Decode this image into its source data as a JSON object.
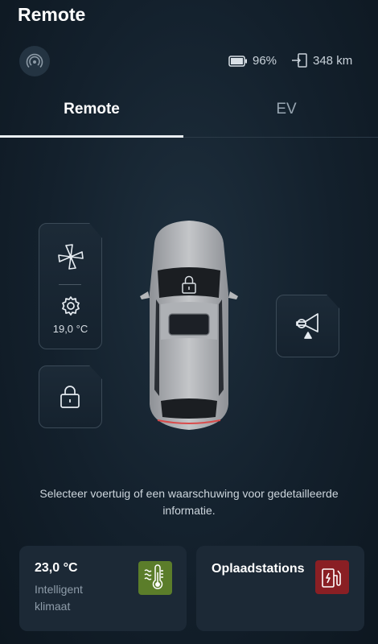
{
  "header": {
    "title": "Remote"
  },
  "status": {
    "battery_percent": "96%",
    "range": "348 km"
  },
  "tabs": [
    {
      "label": "Remote",
      "active": true
    },
    {
      "label": "EV",
      "active": false
    }
  ],
  "controls": {
    "climate_temperature": "19,0 °C"
  },
  "info": {
    "message": "Selecteer voertuig of een waarschuwing voor gedetailleerde informatie."
  },
  "cards": {
    "climate": {
      "temperature": "23,0 °C",
      "subtitle": "Intelligent klimaat",
      "icon": "thermometer-heat-icon",
      "icon_color": "#5b7d2a"
    },
    "stations": {
      "title": "Oplaadstations",
      "icon": "charging-station-icon",
      "icon_color": "#8a1f24"
    }
  },
  "colors": {
    "background": "#0f1a24",
    "tab_indicator": "#e9eef2",
    "card_background": "#1c2936"
  }
}
